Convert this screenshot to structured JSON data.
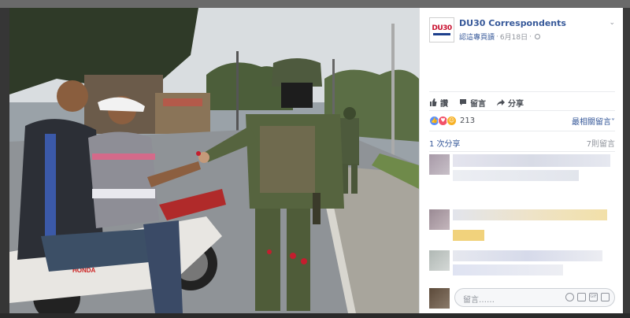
{
  "post": {
    "page_name": "DU30 Correspondents",
    "logo_text": "DU30",
    "see_first": "認這專頁讀",
    "separator": "·",
    "date": "6月18日",
    "menu_icon": "chevron-down-icon"
  },
  "actions": {
    "like_label": "讚",
    "comment_label": "留言",
    "share_label": "分享"
  },
  "reactions": {
    "types": [
      "like",
      "love",
      "haha"
    ],
    "count": "213",
    "sort_label": "最相關留言",
    "sort_icon": "caret-down-icon"
  },
  "stats": {
    "shares": "1 次分享",
    "comments": "7則留言"
  },
  "composer": {
    "placeholder": "留言……",
    "icons": [
      "emoji-icon",
      "camera-icon",
      "gif-icon",
      "sticker-icon"
    ]
  },
  "photo": {
    "sign_text": "HONDA"
  },
  "colors": {
    "link": "#365899",
    "meta": "#90949c",
    "like": "#5890ff",
    "love": "#f25268",
    "haha": "#f7b125"
  }
}
